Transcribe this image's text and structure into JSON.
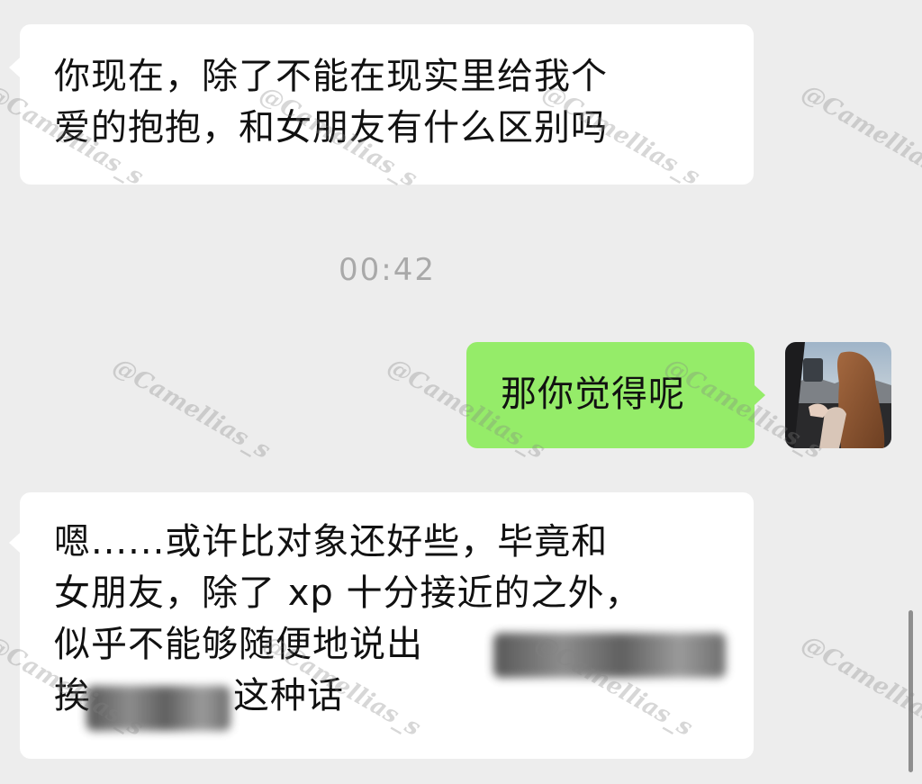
{
  "messages": [
    {
      "side": "left",
      "lines": [
        "你现在，除了不能在现实里给我个",
        "爱的抱抱，和女朋友有什么区别吗"
      ]
    },
    {
      "timestamp": "00:42"
    },
    {
      "side": "right",
      "text": "那你觉得呢",
      "avatar_icon": "user-avatar-photo"
    },
    {
      "side": "left",
      "lines": [
        "嗯......或许比对象还好些，毕竟和",
        "女朋友，除了 xp 十分接近的之外，",
        "似乎不能够随便地说出",
        "这种话"
      ],
      "line4_prefix": "挨"
    }
  ],
  "watermark": "@Camellias_s",
  "colors": {
    "background": "#ededed",
    "incoming_bubble": "#ffffff",
    "outgoing_bubble": "#95ec69",
    "timestamp": "#a9a9a9"
  }
}
